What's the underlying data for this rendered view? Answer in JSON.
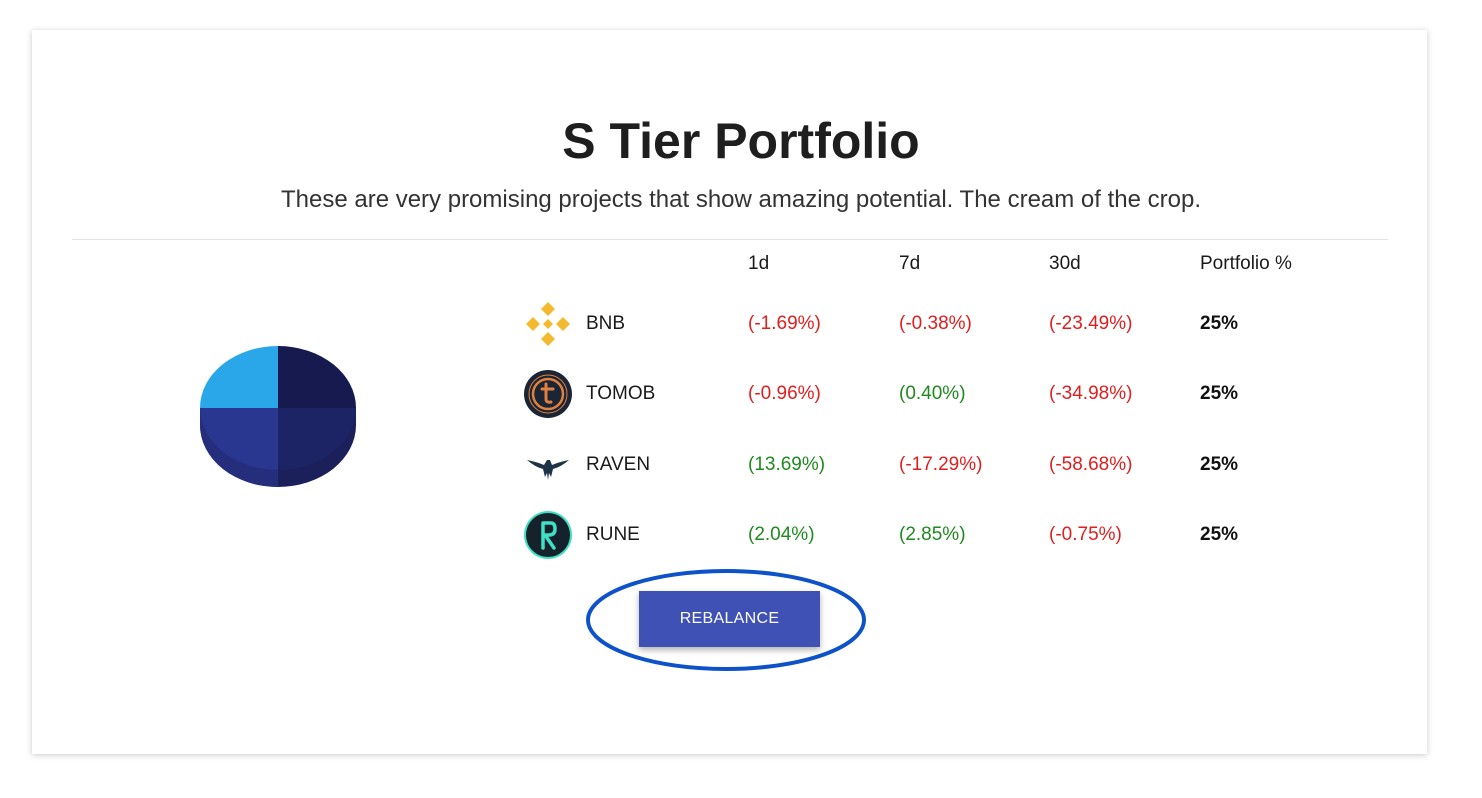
{
  "header": {
    "title": "S Tier Portfolio",
    "subtitle": "These are very promising projects that show amazing potential. The cream of the crop."
  },
  "table": {
    "columns": [
      "1d",
      "7d",
      "30d",
      "Portfolio %"
    ],
    "rows": [
      {
        "icon": "bnb-icon",
        "name": "BNB",
        "d1": "(-1.69%)",
        "d7": "(-0.38%)",
        "d30": "(-23.49%)",
        "portfolio": "25%"
      },
      {
        "icon": "tomob-icon",
        "name": "TOMOB",
        "d1": "(-0.96%)",
        "d7": "(0.40%)",
        "d30": "(-34.98%)",
        "portfolio": "25%"
      },
      {
        "icon": "raven-icon",
        "name": "RAVEN",
        "d1": "(13.69%)",
        "d7": "(-17.29%)",
        "d30": "(-58.68%)",
        "portfolio": "25%"
      },
      {
        "icon": "rune-icon",
        "name": "RUNE",
        "d1": "(2.04%)",
        "d7": "(2.85%)",
        "d30": "(-0.75%)",
        "portfolio": "25%"
      }
    ]
  },
  "allocation_pie": {
    "slices": [
      {
        "coin": "BNB",
        "share": 25,
        "color": "#161a4f"
      },
      {
        "coin": "TOMOB",
        "share": 25,
        "color": "#1d2466"
      },
      {
        "coin": "RAVEN",
        "share": 25,
        "color": "#2a3790"
      },
      {
        "coin": "RUNE",
        "share": 25,
        "color": "#29a7e8"
      }
    ]
  },
  "actions": {
    "rebalance_label": "REBALANCE"
  },
  "colors": {
    "negative": "#e01e1e",
    "positive": "#1f8a1f",
    "button": "#3f51b5",
    "highlight_ring": "#0d52c9"
  }
}
